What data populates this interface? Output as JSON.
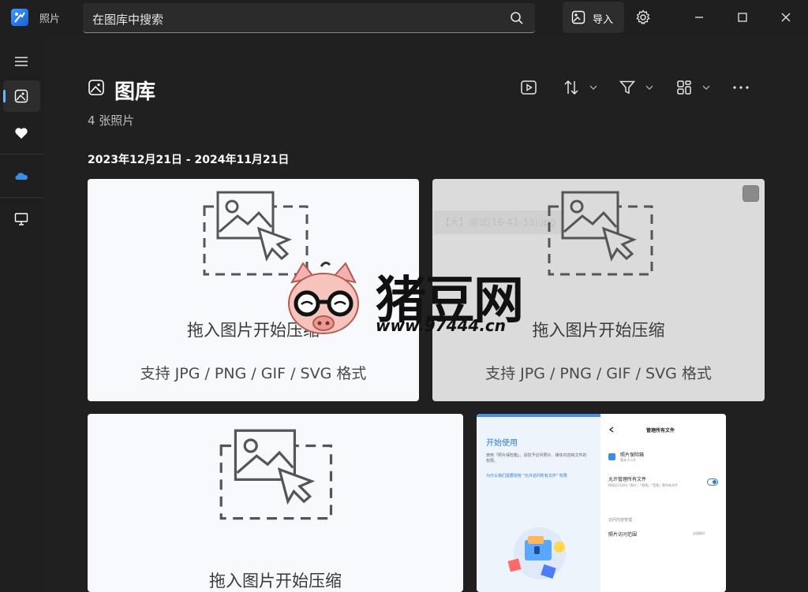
{
  "app": {
    "name": "照片"
  },
  "search": {
    "value": "在图库中搜索"
  },
  "header": {
    "import_label": "导入"
  },
  "main": {
    "title": "图库",
    "photo_count": "4 张照片",
    "date_range": "2023年12月21日 - 2024年11月21日"
  },
  "cards": [
    {
      "line1": "拖入图片开始压缩",
      "line2": "支持 JPG / PNG / GIF / SVG 格式"
    },
    {
      "line1": "拖入图片开始压缩",
      "line2": "支持 JPG / PNG / GIF / SVG 格式",
      "tooltip": "【大】测试(16-41-33).jpg"
    },
    {
      "line1": "拖入图片开始压缩"
    },
    {
      "left_title": "开始使用",
      "left_text": "使用「照片保险箱」，请授予访问照片、媒体内容和文件的权限。",
      "left_link": "为什么我们需要授权 \"允许访问所有文件\" 权限",
      "right_title": "管理所有文件",
      "app_name": "照片保险箱",
      "app_version": "版本 4.3.0",
      "allow_label": "允许管理所有文件",
      "allow_desc": "授权后可访问「照片」「视频」「音频」等所有文件",
      "section_label": "访问内容管理",
      "range_label": "照片访问范围",
      "range_value": "全部照片"
    }
  ],
  "watermark": {
    "title": "猪豆网",
    "url": "www.97444.cn"
  },
  "colors": {
    "accent": "#6cb8ff",
    "background": "#202020",
    "sidebar": "#1f1f1f"
  }
}
